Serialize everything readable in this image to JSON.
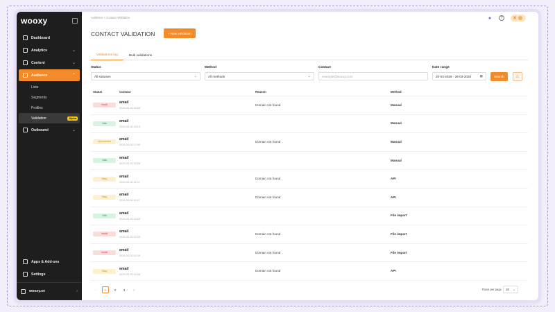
{
  "sidebar": {
    "logo": "wooxy",
    "nav": [
      {
        "label": "Dashboard",
        "icon": "home-icon",
        "chevron": false
      },
      {
        "label": "Analytics",
        "icon": "chart-icon",
        "chevron": true
      },
      {
        "label": "Content",
        "icon": "document-icon",
        "chevron": true
      },
      {
        "label": "Audience",
        "icon": "users-icon",
        "chevron": true,
        "active": true
      }
    ],
    "audience_sub": [
      {
        "label": "Lists"
      },
      {
        "label": "Segments"
      },
      {
        "label": "Profiles"
      },
      {
        "label": "Validation",
        "badge": "Alpha",
        "active": true
      }
    ],
    "outbound": {
      "label": "Outbound",
      "icon": "send-icon"
    },
    "bottom": [
      {
        "label": "Apps & Add-ons",
        "icon": "apps-icon"
      },
      {
        "label": "Settings",
        "icon": "gear-icon"
      }
    ],
    "account": {
      "label": "wooxy.ee",
      "icon": "building-icon"
    }
  },
  "header": {
    "breadcrumb": "Audience  >  Contact Validation",
    "title": "CONTACT VALIDATION",
    "new_button": "+ New validation",
    "user_initials": "DC"
  },
  "tabs": [
    {
      "label": "Validations log",
      "active": true
    },
    {
      "label": "Bulk validations",
      "active": false
    }
  ],
  "filters": {
    "status_label": "Status",
    "status_value": "All statuses",
    "method_label": "Method",
    "method_value": "All methods",
    "contact_label": "Contact",
    "contact_placeholder": "example@wooxy.com",
    "date_label": "Date range",
    "date_value": "20-03-2026 - 26-03-2026",
    "search_button": "Search"
  },
  "table": {
    "columns": [
      "Status",
      "Contact",
      "Reason",
      "Method"
    ],
    "rows": [
      {
        "status": "Invalid",
        "status_color": "#f9dcdc",
        "status_text_color": "#d44",
        "contact": "email",
        "date": "2026-03-26 15:38",
        "reason": "Domain not found",
        "method": "Manual"
      },
      {
        "status": "Valid",
        "status_color": "#d9f3e3",
        "status_text_color": "#2a9a57",
        "contact": "email",
        "date": "2026-03-26 15:18",
        "reason": "",
        "method": "Manual"
      },
      {
        "status": "Unprocessed",
        "status_color": "#fdf0cf",
        "status_text_color": "#c79410",
        "contact": "email",
        "date": "2026-03-26 17:00",
        "reason": "Domain not found",
        "method": "Manual"
      },
      {
        "status": "Valid",
        "status_color": "#d9f3e3",
        "status_text_color": "#2a9a57",
        "contact": "email",
        "date": "2026-03-26 15:38",
        "reason": "",
        "method": "Manual"
      },
      {
        "status": "Risky",
        "status_color": "#fdf0cf",
        "status_text_color": "#c79410",
        "contact": "email",
        "date": "2026-03-26 11:37",
        "reason": "Domain not found",
        "method": "API"
      },
      {
        "status": "Risky",
        "status_color": "#fdf0cf",
        "status_text_color": "#c79410",
        "contact": "email",
        "date": "2026-03-26 11:47",
        "reason": "Domain not found",
        "method": "API"
      },
      {
        "status": "Valid",
        "status_color": "#d9f3e3",
        "status_text_color": "#2a9a57",
        "contact": "email",
        "date": "2026-03-25 14:29",
        "reason": "",
        "method": "File import"
      },
      {
        "status": "Invalid",
        "status_color": "#f9dcdc",
        "status_text_color": "#d44",
        "contact": "email",
        "date": "2026-03-25 10:29",
        "reason": "Domain not found",
        "method": "File import"
      },
      {
        "status": "Invalid",
        "status_color": "#f9dcdc",
        "status_text_color": "#d44",
        "contact": "email",
        "date": "2026-03-25 10:29",
        "reason": "Domain not found",
        "method": "File import"
      },
      {
        "status": "Risky",
        "status_color": "#fdf0cf",
        "status_text_color": "#c79410",
        "contact": "email",
        "date": "2026-03-25 10:06",
        "reason": "Domain not found",
        "method": "API"
      }
    ]
  },
  "pagination": {
    "pages": [
      "1",
      "2",
      "3"
    ],
    "current": "1",
    "rows_per_page_label": "Rows per page",
    "rows_per_page_value": "10"
  },
  "colors": {
    "accent": "#f38b2a",
    "sidebar_bg": "#1e1e1e"
  }
}
